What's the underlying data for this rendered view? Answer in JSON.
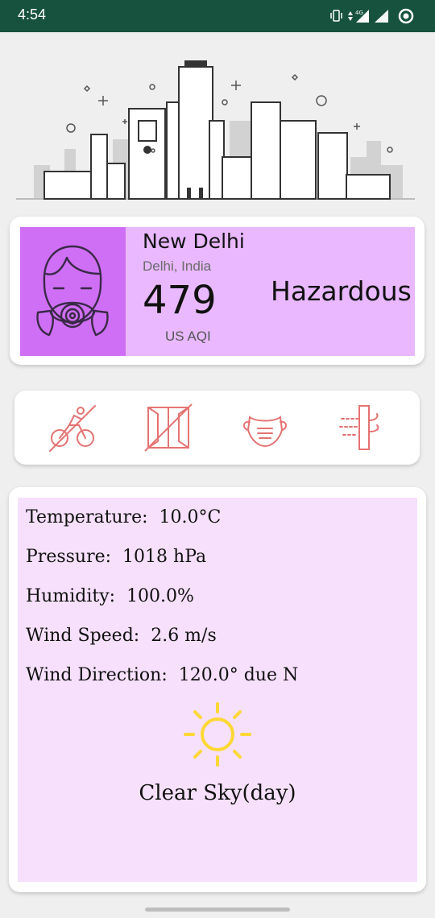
{
  "status_bar": {
    "time": "4:54",
    "network": "4G"
  },
  "aqi": {
    "city": "New Delhi",
    "region": "Delhi, India",
    "value": "479",
    "unit": "US AQI",
    "level": "Hazardous",
    "colors": {
      "card": "#e9b8ff",
      "icon_box": "#cf6ff5"
    }
  },
  "tips": [
    {
      "icon": "no-cycling-icon"
    },
    {
      "icon": "closed-window-icon"
    },
    {
      "icon": "face-mask-icon"
    },
    {
      "icon": "air-purifier-icon"
    }
  ],
  "weather": {
    "temperature": {
      "label": "Temperature:",
      "value": "10.0°C"
    },
    "pressure": {
      "label": "Pressure:",
      "value": "1018 hPa"
    },
    "humidity": {
      "label": "Humidity:",
      "value": "100.0%"
    },
    "wind_speed": {
      "label": "Wind Speed:",
      "value": "2.6 m/s"
    },
    "wind_direction": {
      "label": "Wind Direction:",
      "value": "120.0° due N"
    },
    "condition": "Clear Sky(day)",
    "condition_icon": "sun-icon"
  }
}
